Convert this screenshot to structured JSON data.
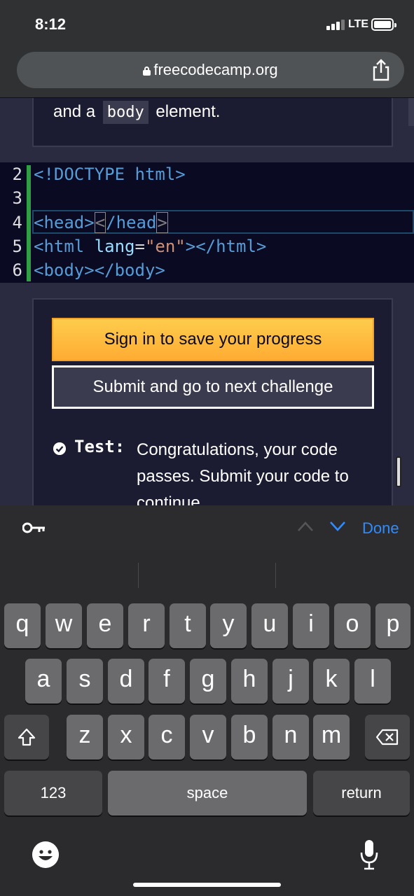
{
  "status_bar": {
    "time": "8:12",
    "network": "LTE"
  },
  "browser": {
    "url": "freecodecamp.org"
  },
  "lesson": {
    "description_prefix": "and a",
    "description_code": "body",
    "description_suffix": "element."
  },
  "editor": {
    "line_numbers": [
      "2",
      "3",
      "4",
      "5",
      "6"
    ],
    "lines": {
      "l2_tag_open": "<!DOCTYPE",
      "l2_rest": " html>",
      "l4_head_open": "<head>",
      "l4_lt": "<",
      "l4_head_close": "/head",
      "l4_gt": ">",
      "l5_open": "<html",
      "l5_attr": " lang",
      "l5_eq": "=",
      "l5_val": "\"en\"",
      "l5_close": "></html>",
      "l6": "<body></body>"
    }
  },
  "actions": {
    "signin_label": "Sign in to save your progress",
    "submit_label": "Submit and go to next challenge",
    "test_label": "Test:",
    "test_text": "Congratulations, your code passes. Submit your code to continue."
  },
  "accessory_bar": {
    "done_label": "Done"
  },
  "keyboard": {
    "row1": [
      "q",
      "w",
      "e",
      "r",
      "t",
      "y",
      "u",
      "i",
      "o",
      "p"
    ],
    "row2": [
      "a",
      "s",
      "d",
      "f",
      "g",
      "h",
      "j",
      "k",
      "l"
    ],
    "row3": [
      "z",
      "x",
      "c",
      "v",
      "b",
      "n",
      "m"
    ],
    "numbers_label": "123",
    "space_label": "space",
    "return_label": "return"
  },
  "colors": {
    "signin_button": "#ffac33",
    "done_blue": "#2f8cff",
    "editor_bg": "#0a0a23",
    "tag_blue": "#569cd6"
  },
  "icons": [
    "lock-icon",
    "share-icon",
    "key-icon",
    "chevron-up-icon",
    "chevron-down-icon",
    "check-circle-icon",
    "shift-icon",
    "delete-icon",
    "emoji-icon",
    "mic-icon"
  ]
}
